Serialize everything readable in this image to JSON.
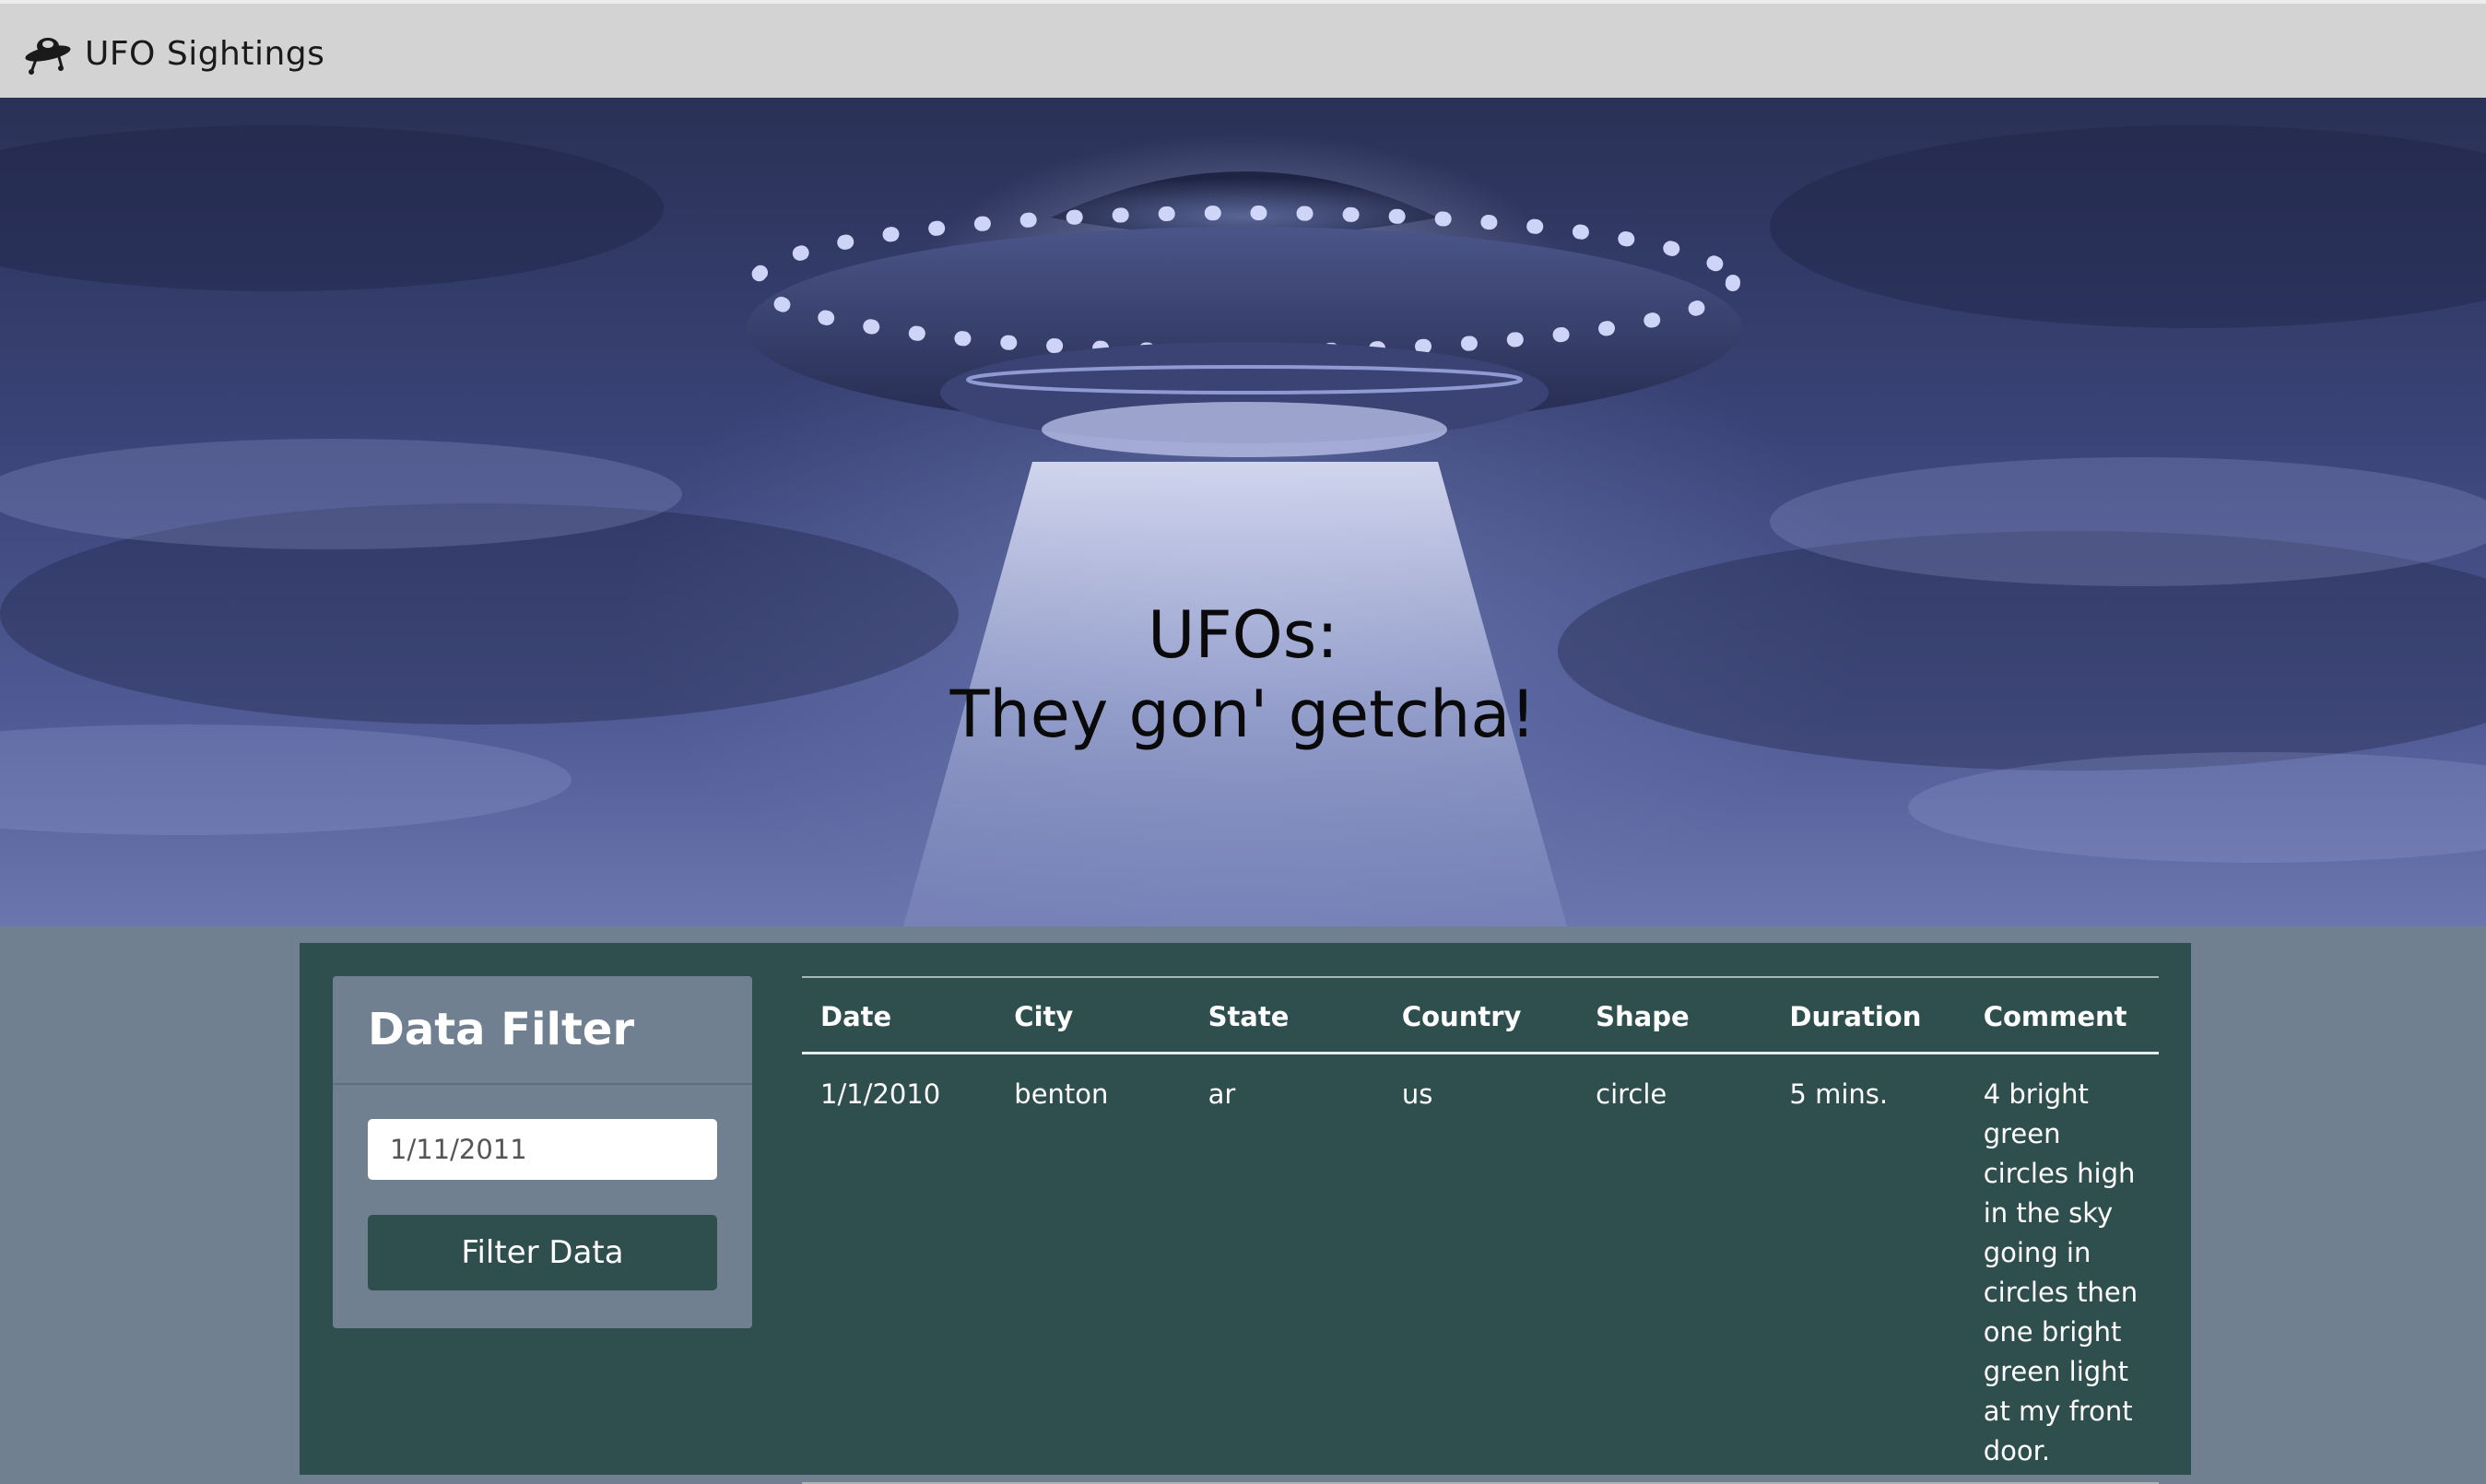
{
  "navbar": {
    "brand_icon": "ufo-icon",
    "brand_title": "UFO Sightings"
  },
  "hero": {
    "title_line1": "UFOs:",
    "title_line2": "They gon' getcha!"
  },
  "filter": {
    "title": "Data Filter",
    "date_value": "1/11/2011",
    "button_label": "Filter Data"
  },
  "table": {
    "headers": [
      "Date",
      "City",
      "State",
      "Country",
      "Shape",
      "Duration",
      "Comment"
    ],
    "rows": [
      [
        "1/1/2010",
        "benton",
        "ar",
        "us",
        "circle",
        "5 mins.",
        "4 bright green circles high in the sky going in circles then one bright green light at my front door."
      ]
    ]
  },
  "colors": {
    "navbar_bg": "#d3d3d3",
    "page_bg": "#708090",
    "panel_bg": "#2f4f4f",
    "filter_card_bg": "#708090",
    "button_bg": "#2f4f4f"
  }
}
